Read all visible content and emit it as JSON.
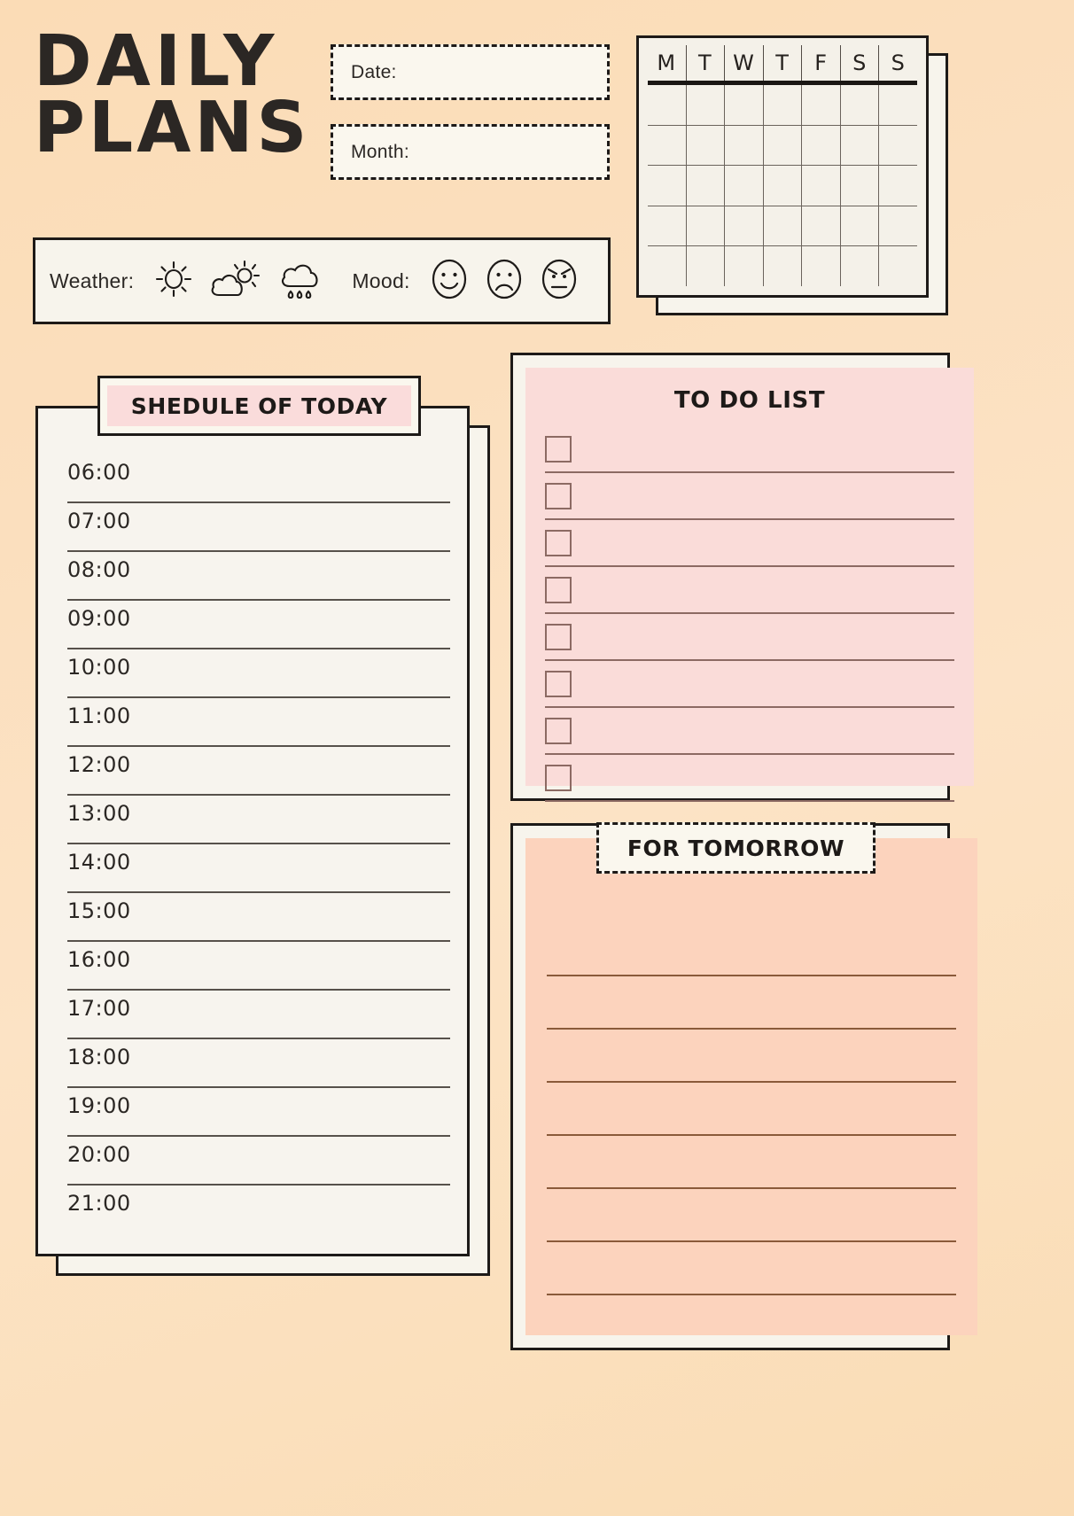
{
  "page": {
    "title_line1": "DAILY",
    "title_line2": "PLANS",
    "background_color": "#fbdfbc",
    "ink_color": "#2b2724"
  },
  "fields": {
    "date_label": "Date:",
    "month_label": "Month:"
  },
  "weather_bar": {
    "weather_label": "Weather:",
    "mood_label": "Mood:",
    "weather_icons": [
      "sun-icon",
      "partly-cloudy-icon",
      "rain-cloud-icon"
    ],
    "mood_icons": [
      "happy-face-icon",
      "sad-face-icon",
      "angry-face-icon"
    ]
  },
  "calendar": {
    "day_headers": [
      "M",
      "T",
      "W",
      "T",
      "F",
      "S",
      "S"
    ],
    "rows": 5,
    "columns": 7
  },
  "schedule": {
    "title": "SHEDULE OF TODAY",
    "accent_color": "#fadcdb",
    "times": [
      "06:00",
      "07:00",
      "08:00",
      "09:00",
      "10:00",
      "11:00",
      "12:00",
      "13:00",
      "14:00",
      "15:00",
      "16:00",
      "17:00",
      "18:00",
      "19:00",
      "20:00",
      "21:00"
    ]
  },
  "todo": {
    "title": "TO DO LIST",
    "panel_color": "#fadcd9",
    "item_count": 8,
    "items": [
      "",
      "",
      "",
      "",
      "",
      "",
      "",
      ""
    ]
  },
  "tomorrow": {
    "title": "FOR TOMORROW",
    "panel_color": "#fcd3bd",
    "line_count": 8,
    "lines": [
      "",
      "",
      "",
      "",
      "",
      "",
      "",
      ""
    ]
  }
}
